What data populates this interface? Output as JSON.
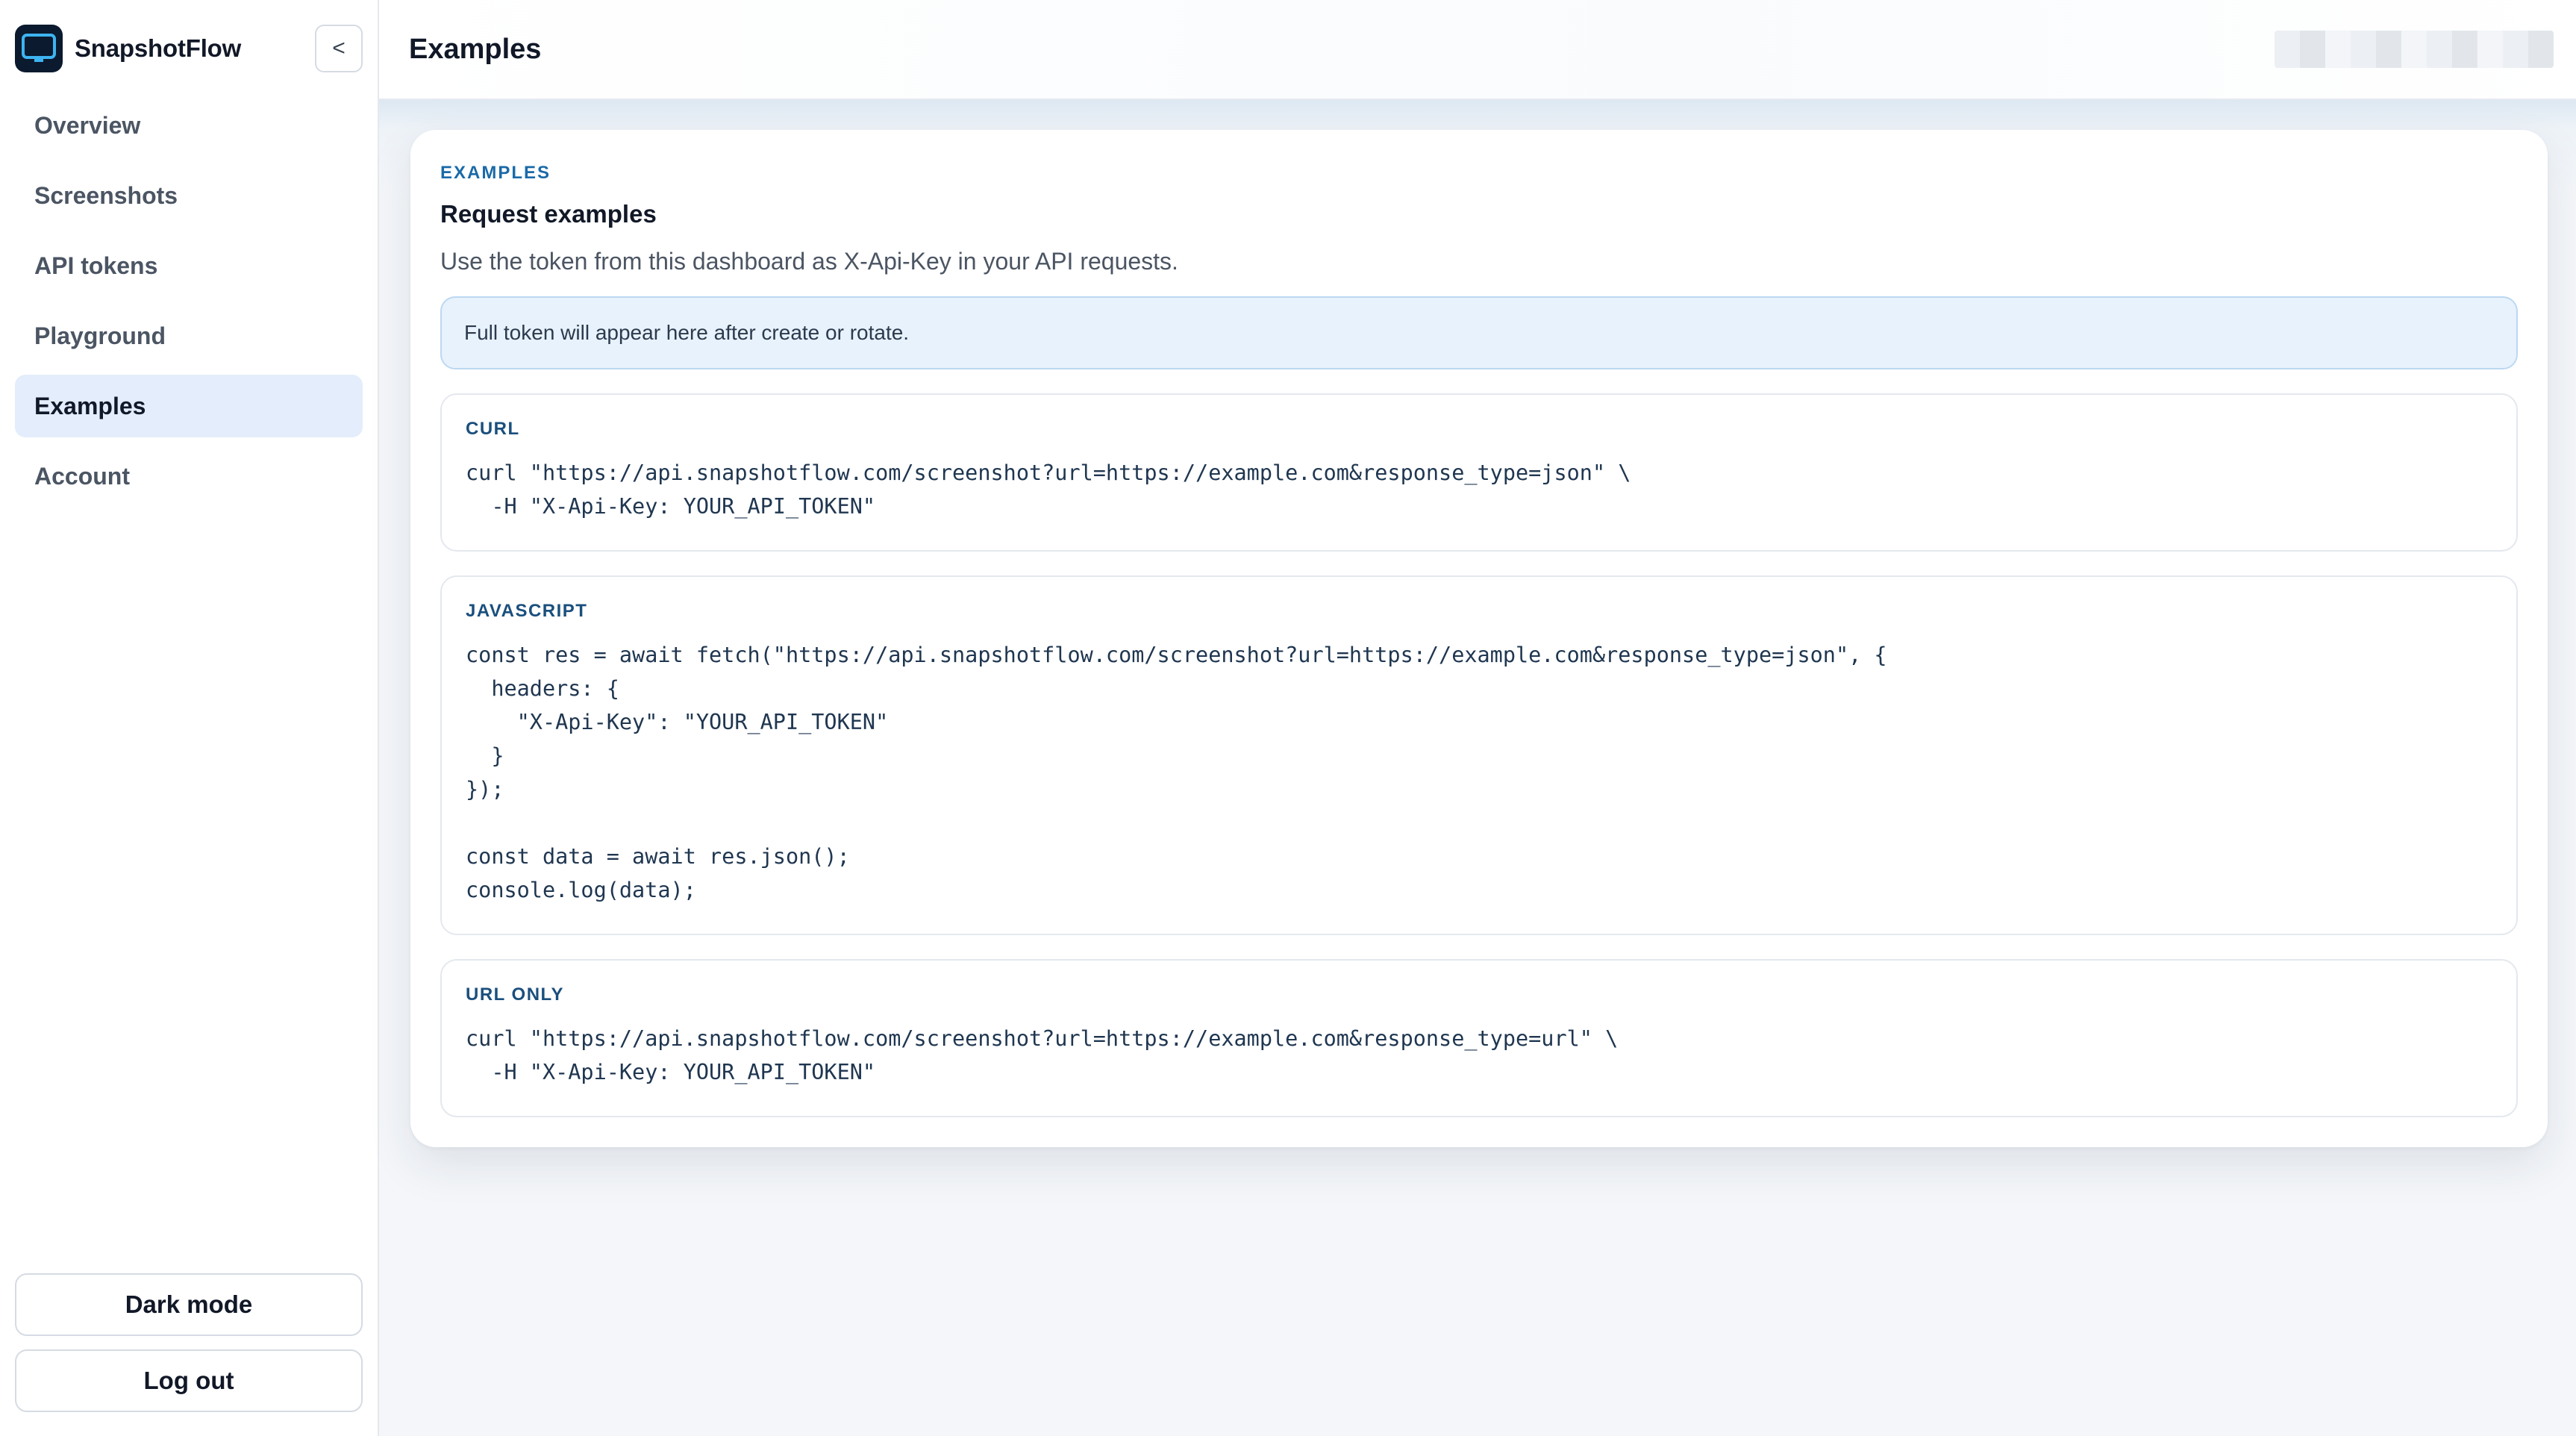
{
  "app": {
    "name": "SnapshotFlow",
    "collapse_label": "<"
  },
  "sidebar": {
    "items": [
      {
        "label": "Overview",
        "active": false
      },
      {
        "label": "Screenshots",
        "active": false
      },
      {
        "label": "API tokens",
        "active": false
      },
      {
        "label": "Playground",
        "active": false
      },
      {
        "label": "Examples",
        "active": true
      },
      {
        "label": "Account",
        "active": false
      }
    ],
    "dark_mode_label": "Dark mode",
    "logout_label": "Log out"
  },
  "header": {
    "title": "Examples"
  },
  "card": {
    "eyebrow": "EXAMPLES",
    "title": "Request examples",
    "description": "Use the token from this dashboard as X-Api-Key in your API requests.",
    "token_notice": "Full token will appear here after create or rotate.",
    "examples": [
      {
        "label": "CURL",
        "code": "curl \"https://api.snapshotflow.com/screenshot?url=https://example.com&response_type=json\" \\\n  -H \"X-Api-Key: YOUR_API_TOKEN\""
      },
      {
        "label": "JAVASCRIPT",
        "code": "const res = await fetch(\"https://api.snapshotflow.com/screenshot?url=https://example.com&response_type=json\", {\n  headers: {\n    \"X-Api-Key\": \"YOUR_API_TOKEN\"\n  }\n});\n\nconst data = await res.json();\nconsole.log(data);"
      },
      {
        "label": "URL ONLY",
        "code": "curl \"https://api.snapshotflow.com/screenshot?url=https://example.com&response_type=url\" \\\n  -H \"X-Api-Key: YOUR_API_TOKEN\""
      }
    ]
  },
  "colors": {
    "accent": "#1a6aa8",
    "active_nav_bg": "#e3edfb",
    "notice_bg": "#e8f2fc",
    "logo_bg": "#0b1a2e",
    "logo_screen": "#3db4f2"
  },
  "icons": {
    "logo": "monitor-icon",
    "collapse": "chevron-left-icon"
  }
}
